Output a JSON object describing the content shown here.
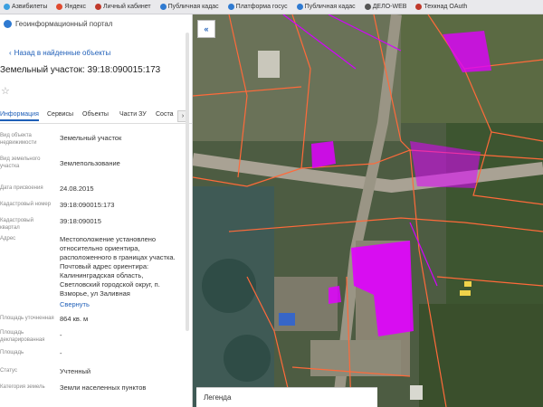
{
  "bookmarks": [
    {
      "label": "Азвибилеты",
      "color": "#3b9fe0"
    },
    {
      "label": "Яндекс",
      "color": "#e04a2f"
    },
    {
      "label": "Личный кабинет",
      "color": "#c0392b"
    },
    {
      "label": "Публичная кадас",
      "color": "#2f7ad1"
    },
    {
      "label": "Платформа госус",
      "color": "#2f7ad1"
    },
    {
      "label": "Публичная кадас",
      "color": "#2f7ad1"
    },
    {
      "label": "ДЕЛО-WEB",
      "color": "#555555"
    },
    {
      "label": "Техкнад OAuth",
      "color": "#c0392b"
    }
  ],
  "panel": {
    "portal_title": "Геоинформационный портал",
    "back_link": "Назад в найденные объекты",
    "object_title": "Земельный участок: 39:18:090015:173",
    "tabs": [
      "Информация",
      "Сервисы",
      "Объекты",
      "Части ЗУ",
      "Соста"
    ],
    "fields": [
      {
        "label": "Вид объекта недвижимости",
        "value": "Земельный участок"
      },
      {
        "label": "Вид земельного участка",
        "value": "Землепользование"
      },
      {
        "label": "Дата присвоения",
        "value": "24.08.2015"
      },
      {
        "label": "Кадастровый номер",
        "value": "39:18:090015:173"
      },
      {
        "label": "Кадастровый квартал",
        "value": "39:18:090015"
      },
      {
        "label": "Адрес",
        "value": "Местоположение установлено относительно ориентира, расположенного в границах участка. Почтовый адрес ориентира: Калининградская область, Светловский городской округ, п. Взморье, ул Заливная"
      },
      {
        "label": "Площадь уточненная",
        "value": "864 кв. м"
      },
      {
        "label": "Площадь декларированная",
        "value": "-"
      },
      {
        "label": "Площадь",
        "value": "-"
      },
      {
        "label": "Статус",
        "value": "Учтенный"
      },
      {
        "label": "Категория земель",
        "value": "Земли населенных пунктов"
      }
    ],
    "collapse_link": "Свернуть"
  },
  "map": {
    "legend_label": "Легенда",
    "collapse_icon": "double-chevron-left-icon"
  },
  "colors": {
    "accent": "#1f5fb8",
    "parcel_line": "#ff6a3a",
    "parcel_fill": "#e000ff"
  }
}
